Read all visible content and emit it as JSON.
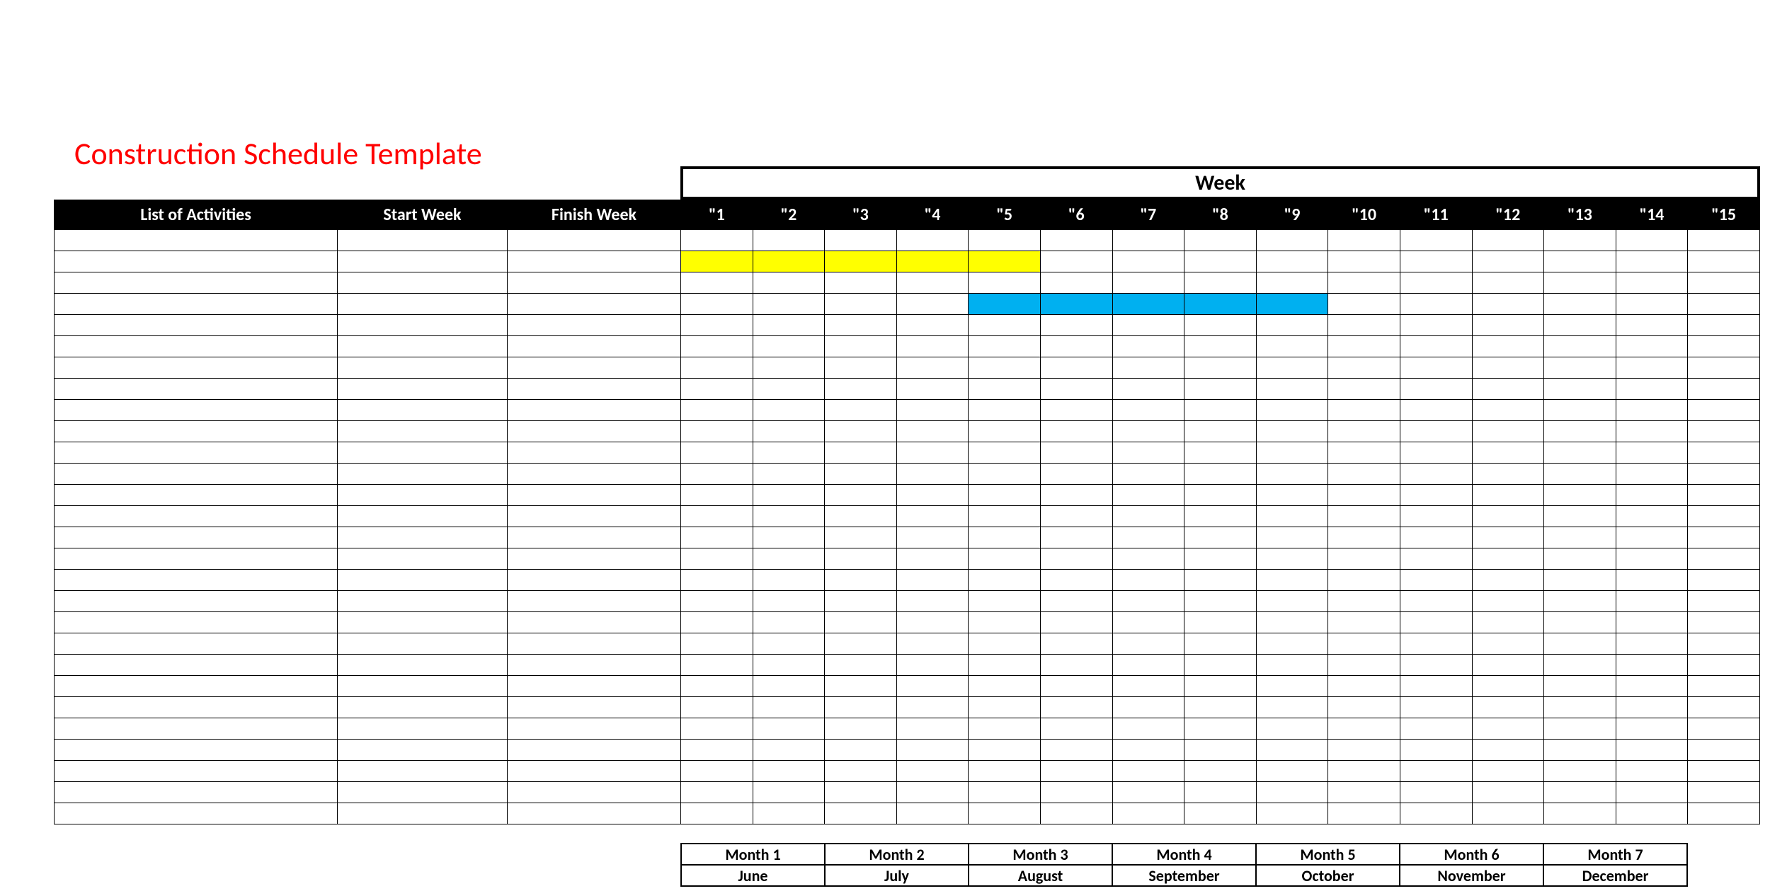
{
  "title": "Construction Schedule Template",
  "week_header": "Week",
  "columns": {
    "activities": "List of Activities",
    "start": "Start Week",
    "finish": "Finish Week",
    "weeks": [
      "\"1",
      "\"2",
      "\"3",
      "\"4",
      "\"5",
      "\"6",
      "\"7",
      "\"8",
      "\"9",
      "\"10",
      "\"11",
      "\"12",
      "\"13",
      "\"14",
      "\"15"
    ]
  },
  "row_count": 28,
  "bars": [
    {
      "row": 1,
      "start_week": 1,
      "end_week": 5,
      "color": "yellow"
    },
    {
      "row": 3,
      "start_week": 5,
      "end_week": 9,
      "color": "blue"
    }
  ],
  "months": {
    "labels": [
      "Month 1",
      "Month 2",
      "Month 3",
      "Month 4",
      "Month 5",
      "Month 6",
      "Month 7"
    ],
    "names": [
      "June",
      "July",
      "August",
      "September",
      "October",
      "November",
      "December"
    ]
  },
  "chart_data": {
    "type": "gantt",
    "title": "Construction Schedule Template",
    "xlabel": "Week",
    "x_ticks": [
      1,
      2,
      3,
      4,
      5,
      6,
      7,
      8,
      9,
      10,
      11,
      12,
      13,
      14,
      15
    ],
    "month_axis": [
      {
        "label": "Month 1",
        "name": "June"
      },
      {
        "label": "Month 2",
        "name": "July"
      },
      {
        "label": "Month 3",
        "name": "August"
      },
      {
        "label": "Month 4",
        "name": "September"
      },
      {
        "label": "Month 5",
        "name": "October"
      },
      {
        "label": "Month 6",
        "name": "November"
      },
      {
        "label": "Month 7",
        "name": "December"
      }
    ],
    "tasks": [
      {
        "row": 1,
        "start": 1,
        "end": 5,
        "color": "#ffff00"
      },
      {
        "row": 3,
        "start": 5,
        "end": 9,
        "color": "#00b0f0"
      }
    ]
  }
}
